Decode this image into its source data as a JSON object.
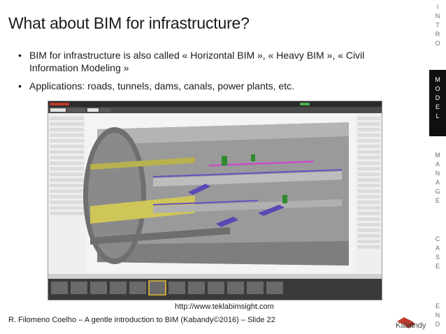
{
  "slide": {
    "title": "What about BIM for infrastructure?",
    "bullets": [
      "BIM for infrastructure is also called « Horizontal BIM », « Heavy BIM », « Civil Information Modeling »",
      "Applications: roads, tunnels, dams, canals, power plants, etc."
    ],
    "url": "http://www.teklabimsight.com",
    "footer": "R. Filomeno Coelho – A gentle introduction to BIM (Kabandy©2016) – Slide 22",
    "logo_text": "Kabandy"
  },
  "nav": {
    "sections": [
      {
        "letters": [
          "I",
          "N",
          "T",
          "R",
          "O"
        ],
        "active": false
      },
      {
        "letters": [
          "M",
          "O",
          "D",
          "E",
          "L"
        ],
        "active": true
      },
      {
        "letters": [
          "M",
          "A",
          "N",
          "A",
          "G",
          "E"
        ],
        "active": false
      },
      {
        "letters": [
          "C",
          "A",
          "S",
          "E"
        ],
        "active": false
      },
      {
        "letters": [
          "E",
          "N",
          "D"
        ],
        "active": false
      }
    ]
  },
  "colors": {
    "accent_red": "#c0392b",
    "nav_active_bg": "#0f0f0f",
    "software_chrome": "#3a3a3a",
    "highlight_green": "#4caf50",
    "tunnel_gray": "#8e8e8e",
    "floor_yellow": "#cfc65a",
    "rail_purple": "#6a4fbf"
  },
  "icons": {
    "logo": "kabandy-logo-icon"
  }
}
